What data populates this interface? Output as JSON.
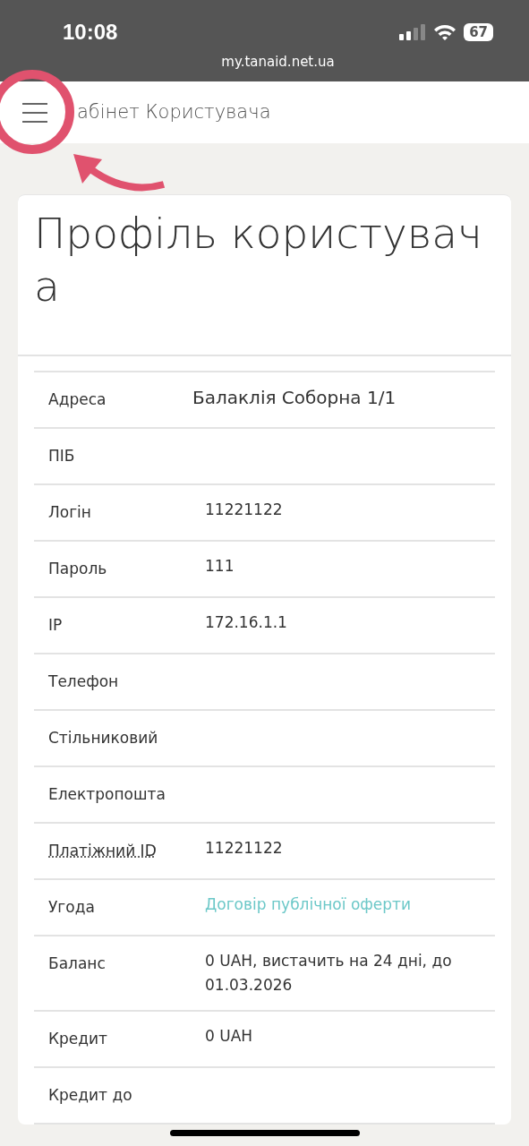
{
  "status_bar": {
    "time": "10:08",
    "battery": "67",
    "url": "my.tanaid.net.ua"
  },
  "header": {
    "title": "абінет Користувача"
  },
  "profile": {
    "title": "Профіль користувача",
    "rows": [
      {
        "label": "Адреса",
        "value": "Балаклія Соборна 1/1",
        "kind": "address",
        "dotted": false
      },
      {
        "label": "ПІБ",
        "kind": "text",
        "dotted": false
      },
      {
        "label": "Логін",
        "value": "11221122",
        "kind": "text",
        "dotted": false
      },
      {
        "label": "Пароль",
        "value": "111",
        "kind": "text",
        "dotted": false
      },
      {
        "label": "IP",
        "value": "172.16.1.1",
        "kind": "text",
        "dotted": false
      },
      {
        "label": "Телефон",
        "kind": "text",
        "dotted": false
      },
      {
        "label": "Стільниковий",
        "kind": "text",
        "dotted": false
      },
      {
        "label": "Електропошта",
        "kind": "text",
        "dotted": false
      },
      {
        "label": "Платіжний ID",
        "value": "11221122",
        "kind": "text",
        "dotted": true
      },
      {
        "label": "Угода",
        "value": "Договір публічної оферти",
        "kind": "link",
        "dotted": false
      },
      {
        "label": "Баланс",
        "value": "0 UAH, вистачить на 24 дні, до 01.03.2026",
        "kind": "text",
        "dotted": false
      },
      {
        "label": "Кредит",
        "value": "0 UAH",
        "kind": "text",
        "dotted": false
      },
      {
        "label": "Кредит до",
        "kind": "text",
        "dotted": false
      }
    ]
  }
}
